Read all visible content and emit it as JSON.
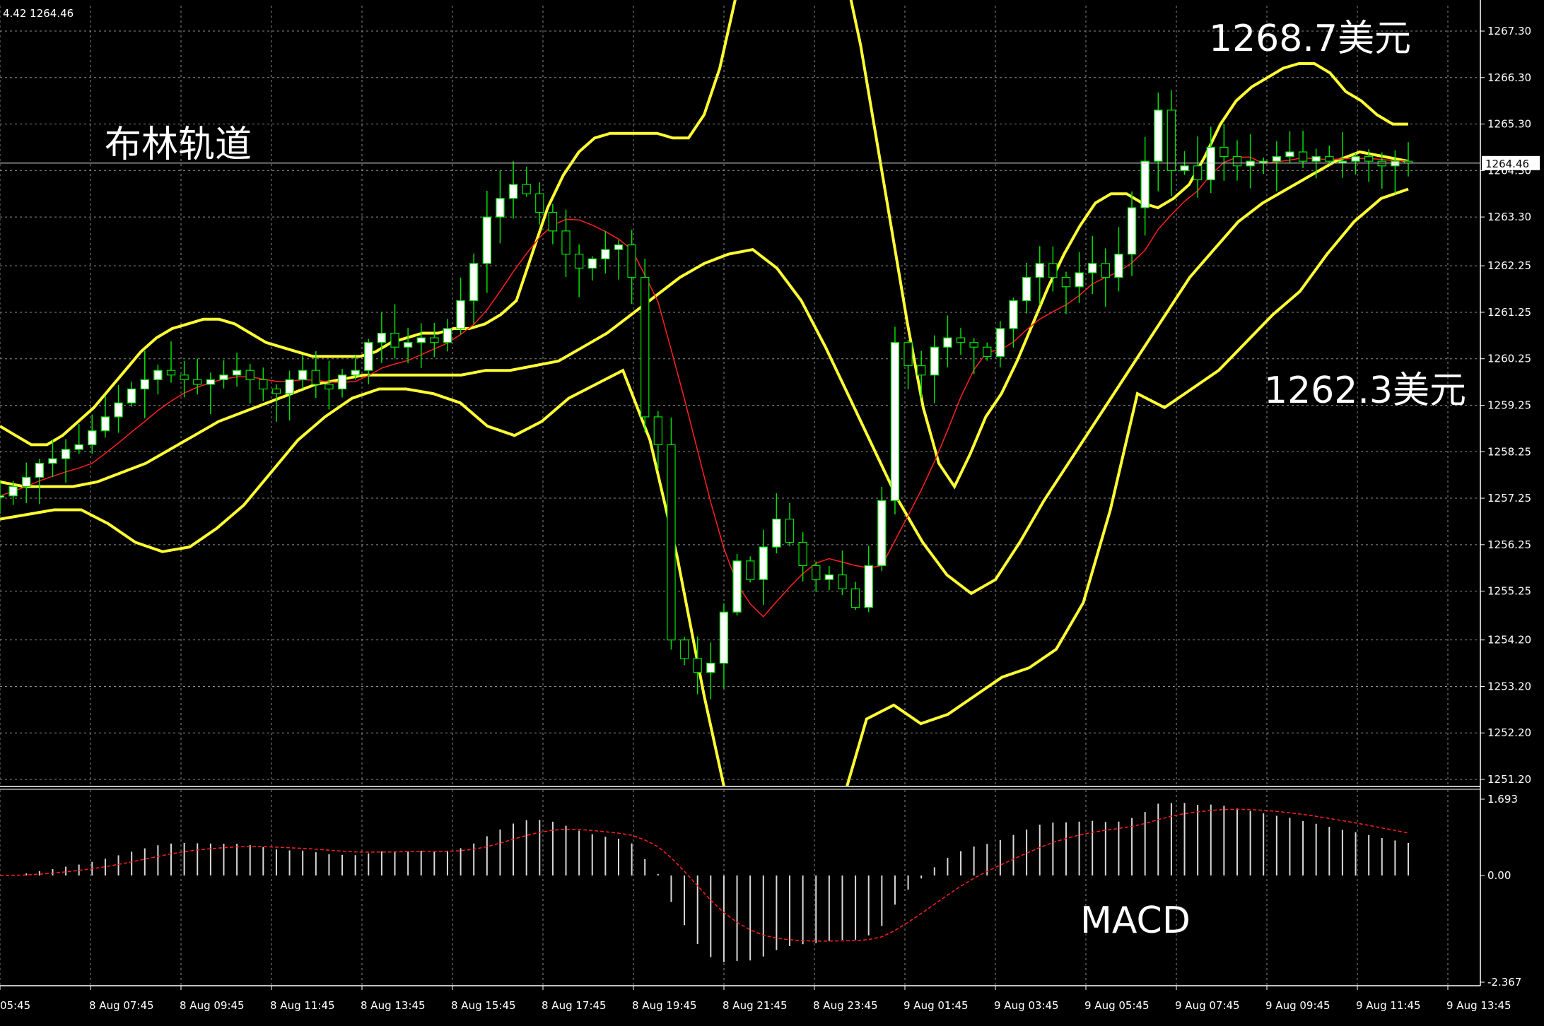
{
  "header": {
    "ohlc": "4.42 1264.46"
  },
  "annotations": {
    "title": "布林轨道",
    "upper_value": "1268.7美元",
    "lower_value": "1262.3美元",
    "macd_label": "MACD"
  },
  "colors": {
    "background": "#000000",
    "grid": "#8c8c8c",
    "bull_candle": "#ffffff",
    "bear_candle": "#000000",
    "wick": "#00e000",
    "bollinger": "#ffff33",
    "sma": "#ff2020",
    "macd_hist": "#d8d8d8",
    "macd_signal": "#ff2020",
    "current_price_line": "#c8c8c8"
  },
  "chart_data": [
    {
      "type": "candlestick",
      "title": "布林轨道",
      "current_price": 1264.46,
      "ylim": [
        1251.2,
        1267.3
      ],
      "yticks": [
        "1267.30",
        "1266.30",
        "1265.30",
        "1264.30",
        "1263.30",
        "1262.25",
        "1261.25",
        "1260.25",
        "1259.25",
        "1258.25",
        "1257.25",
        "1256.25",
        "1255.25",
        "1254.20",
        "1253.20",
        "1252.20",
        "1251.20"
      ],
      "xticks": [
        "05:45",
        "8 Aug 07:45",
        "8 Aug 09:45",
        "8 Aug 11:45",
        "8 Aug 13:45",
        "8 Aug 15:45",
        "8 Aug 17:45",
        "8 Aug 19:45",
        "8 Aug 21:45",
        "8 Aug 23:45",
        "9 Aug 01:45",
        "9 Aug 03:45",
        "9 Aug 05:45",
        "9 Aug 07:45",
        "9 Aug 09:45",
        "9 Aug 11:45",
        "9 Aug 13:45"
      ],
      "grid": true,
      "close": [
        1257.3,
        1257.5,
        1257.7,
        1258.0,
        1258.1,
        1258.3,
        1258.4,
        1258.7,
        1259.0,
        1259.3,
        1259.6,
        1259.8,
        1260.0,
        1259.9,
        1259.8,
        1259.7,
        1259.8,
        1259.9,
        1260.0,
        1259.8,
        1259.6,
        1259.5,
        1259.8,
        1260.0,
        1259.7,
        1259.6,
        1259.9,
        1260.0,
        1260.6,
        1260.8,
        1260.5,
        1260.6,
        1260.7,
        1260.6,
        1260.9,
        1261.5,
        1262.3,
        1263.3,
        1263.7,
        1264.0,
        1263.8,
        1263.4,
        1263.0,
        1262.5,
        1262.2,
        1262.4,
        1262.6,
        1262.7,
        1262.0,
        1259.0,
        1258.4,
        1254.2,
        1253.8,
        1253.5,
        1253.7,
        1254.8,
        1255.9,
        1255.5,
        1256.2,
        1256.8,
        1256.3,
        1255.8,
        1255.5,
        1255.6,
        1255.3,
        1254.9,
        1255.8,
        1257.2,
        1260.6,
        1260.1,
        1259.9,
        1260.5,
        1260.7,
        1260.6,
        1260.5,
        1260.3,
        1260.9,
        1261.5,
        1262.0,
        1262.3,
        1262.0,
        1261.8,
        1262.1,
        1262.3,
        1262.0,
        1262.5,
        1263.5,
        1264.5,
        1265.6,
        1264.3,
        1264.4,
        1264.1,
        1264.8,
        1264.6,
        1264.4,
        1264.5,
        1264.5,
        1264.6,
        1264.7,
        1264.5,
        1264.6,
        1264.5,
        1264.5,
        1264.6,
        1264.5,
        1264.4,
        1264.5,
        1264.46
      ],
      "bb_upper": [
        1258.8,
        1258.6,
        1258.4,
        1258.4,
        1258.6,
        1258.9,
        1259.2,
        1259.6,
        1260.0,
        1260.4,
        1260.7,
        1260.9,
        1261.0,
        1261.1,
        1261.1,
        1261.0,
        1260.8,
        1260.6,
        1260.5,
        1260.4,
        1260.3,
        1260.3,
        1260.3,
        1260.3,
        1260.4,
        1260.6,
        1260.7,
        1260.8,
        1260.8,
        1260.9,
        1260.9,
        1261.0,
        1261.2,
        1261.5,
        1262.5,
        1263.5,
        1264.2,
        1264.7,
        1265.0,
        1265.1,
        1265.1,
        1265.1,
        1265.1,
        1265.0,
        1265.0,
        1265.5,
        1266.5,
        1268.0,
        1270.0,
        1272.0,
        1273.5,
        1274.0,
        1273.0,
        1271.0,
        1269.0,
        1267.0,
        1265.0,
        1263.0,
        1261.0,
        1259.2,
        1258.0,
        1257.5,
        1258.2,
        1259.0,
        1259.5,
        1260.2,
        1261.0,
        1261.8,
        1262.5,
        1263.1,
        1263.6,
        1263.8,
        1263.8,
        1263.6,
        1263.5,
        1263.7,
        1264.0,
        1264.6,
        1265.3,
        1265.8,
        1266.1,
        1266.3,
        1266.5,
        1266.6,
        1266.6,
        1266.4,
        1266.0,
        1265.8,
        1265.5,
        1265.3,
        1265.3
      ],
      "bb_middle": [
        1257.6,
        1257.5,
        1257.5,
        1257.5,
        1257.6,
        1257.8,
        1258.0,
        1258.3,
        1258.6,
        1258.9,
        1259.1,
        1259.3,
        1259.5,
        1259.7,
        1259.8,
        1259.9,
        1259.9,
        1259.9,
        1259.9,
        1259.9,
        1260.0,
        1260.0,
        1260.1,
        1260.2,
        1260.5,
        1260.8,
        1261.2,
        1261.6,
        1262.0,
        1262.3,
        1262.5,
        1262.6,
        1262.2,
        1261.5,
        1260.5,
        1259.4,
        1258.3,
        1257.2,
        1256.3,
        1255.6,
        1255.2,
        1255.5,
        1256.3,
        1257.2,
        1258.0,
        1258.8,
        1259.6,
        1260.4,
        1261.2,
        1262.0,
        1262.6,
        1263.2,
        1263.6,
        1263.9,
        1264.2,
        1264.5,
        1264.7,
        1264.6,
        1264.5
      ],
      "bb_lower": [
        1256.8,
        1256.9,
        1257.0,
        1257.0,
        1256.7,
        1256.3,
        1256.1,
        1256.2,
        1256.6,
        1257.1,
        1257.8,
        1258.5,
        1259.0,
        1259.4,
        1259.6,
        1259.6,
        1259.5,
        1259.3,
        1258.8,
        1258.6,
        1258.9,
        1259.4,
        1259.7,
        1260.0,
        1258.5,
        1256.0,
        1253.0,
        1249.5,
        1248.0,
        1247.5,
        1248.5,
        1250.5,
        1252.5,
        1252.8,
        1252.4,
        1252.6,
        1253.0,
        1253.4,
        1253.6,
        1254.0,
        1255.0,
        1257.0,
        1259.5,
        1259.2,
        1259.6,
        1260.0,
        1260.6,
        1261.2,
        1261.7,
        1262.5,
        1263.2,
        1263.7,
        1263.9
      ],
      "macd_ylim": [
        -2.367,
        1.693
      ],
      "macd_ticks": [
        "1.693",
        "0.00",
        "-2.367"
      ]
    }
  ]
}
